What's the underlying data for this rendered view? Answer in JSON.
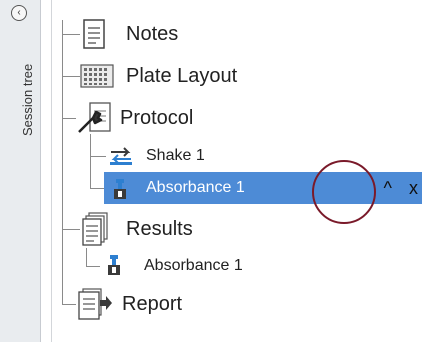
{
  "rail": {
    "label": "Session tree",
    "collapse_icon": "chevron-left-icon"
  },
  "tree": {
    "items": [
      {
        "label": "Notes",
        "icon": "notes-icon"
      },
      {
        "label": "Plate Layout",
        "icon": "plate-layout-icon"
      },
      {
        "label": "Protocol",
        "icon": "protocol-wrench-icon"
      },
      {
        "label": "Shake 1",
        "icon": "shake-icon"
      },
      {
        "label": "Absorbance 1",
        "icon": "absorbance-icon",
        "selected": true
      },
      {
        "label": "Results",
        "icon": "results-icon"
      },
      {
        "label": "Absorbance 1",
        "icon": "absorbance-icon"
      },
      {
        "label": "Report",
        "icon": "report-icon"
      }
    ],
    "selected_actions": {
      "move_up": "^",
      "close": "x"
    }
  },
  "colors": {
    "selected_bg": "#4d8bd6",
    "annotation_circle": "#7a1a2a"
  }
}
